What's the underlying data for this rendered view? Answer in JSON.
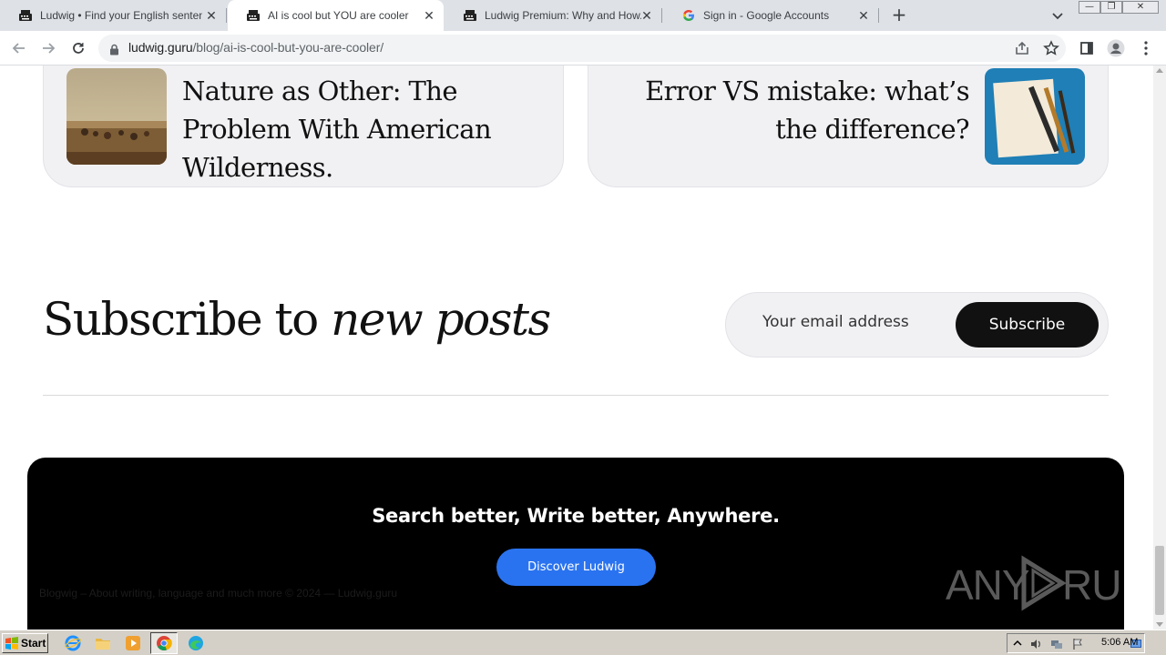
{
  "browser": {
    "tabs": [
      {
        "title": "Ludwig • Find your English sentence",
        "icon": "typewriter-icon",
        "active": false
      },
      {
        "title": "AI is cool but YOU are cooler",
        "icon": "typewriter-icon",
        "active": true
      },
      {
        "title": "Ludwig Premium: Why and How. An",
        "icon": "typewriter-icon",
        "active": false
      },
      {
        "title": "Sign in - Google Accounts",
        "icon": "google-icon",
        "active": false
      }
    ],
    "new_tab_label": "+",
    "url_domain": "ludwig.guru",
    "url_path": "/blog/ai-is-cool-but-you-are-cooler/"
  },
  "related_posts": [
    {
      "title": "Nature as Other: The Problem With American Wilderness."
    },
    {
      "title": "Error VS mistake: what’s the difference?"
    }
  ],
  "subscribe": {
    "heading_prefix": "Subscribe to ",
    "heading_emphasis": "new posts",
    "email_placeholder": "Your email address",
    "button_label": "Subscribe"
  },
  "footer": {
    "tagline": "Search better, Write better, Anywhere.",
    "cta_label": "Discover Ludwig",
    "copyright": "Blogwig – About writing, language and much more © 2024 — Ludwig.guru"
  },
  "watermark": "ANY RUN",
  "taskbar": {
    "start_label": "Start",
    "clock": "5:06 AM"
  },
  "colors": {
    "tab_bar": "#dee1e6",
    "card_bg": "#f1f1f4",
    "footer_bg": "#000000",
    "cta_blue": "#2a73f0",
    "subscribe_btn": "#111111"
  }
}
